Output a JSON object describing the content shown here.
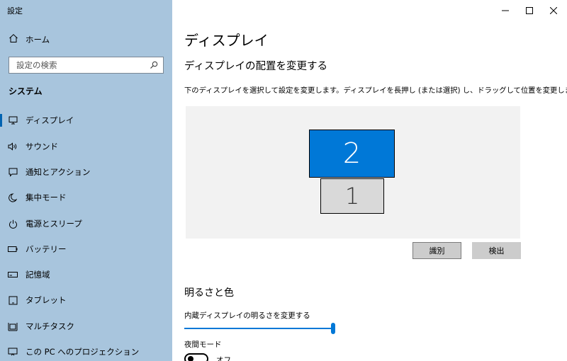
{
  "app": {
    "title": "設定"
  },
  "sidebar": {
    "home_label": "ホーム",
    "search_placeholder": "設定の検索",
    "section_title": "システム",
    "items": [
      {
        "label": "ディスプレイ",
        "icon": "monitor-icon",
        "active": true
      },
      {
        "label": "サウンド",
        "icon": "speaker-icon"
      },
      {
        "label": "通知とアクション",
        "icon": "notification-icon"
      },
      {
        "label": "集中モード",
        "icon": "moon-icon"
      },
      {
        "label": "電源とスリープ",
        "icon": "power-icon"
      },
      {
        "label": "バッテリー",
        "icon": "battery-icon"
      },
      {
        "label": "記憶域",
        "icon": "storage-icon"
      },
      {
        "label": "タブレット",
        "icon": "tablet-icon"
      },
      {
        "label": "マルチタスク",
        "icon": "multitask-icon"
      },
      {
        "label": "この PC へのプロジェクション",
        "icon": "projection-icon"
      }
    ]
  },
  "main": {
    "page_title": "ディスプレイ",
    "arrange_heading": "ディスプレイの配置を変更する",
    "arrange_desc": "下のディスプレイを選択して設定を変更します。ディスプレイを長押し (または選択) し、ドラッグして位置を変更します。",
    "monitors": {
      "primary_label": "1",
      "secondary_label": "2"
    },
    "identify_label": "識別",
    "detect_label": "検出",
    "color_heading": "明るさと色",
    "brightness_label": "内蔵ディスプレイの明るさを変更する",
    "brightness_value": 100,
    "night_label": "夜間モード",
    "night_state": "オフ"
  },
  "colors": {
    "sidebar_bg": "#a8c5dd",
    "accent": "#0078d7"
  }
}
